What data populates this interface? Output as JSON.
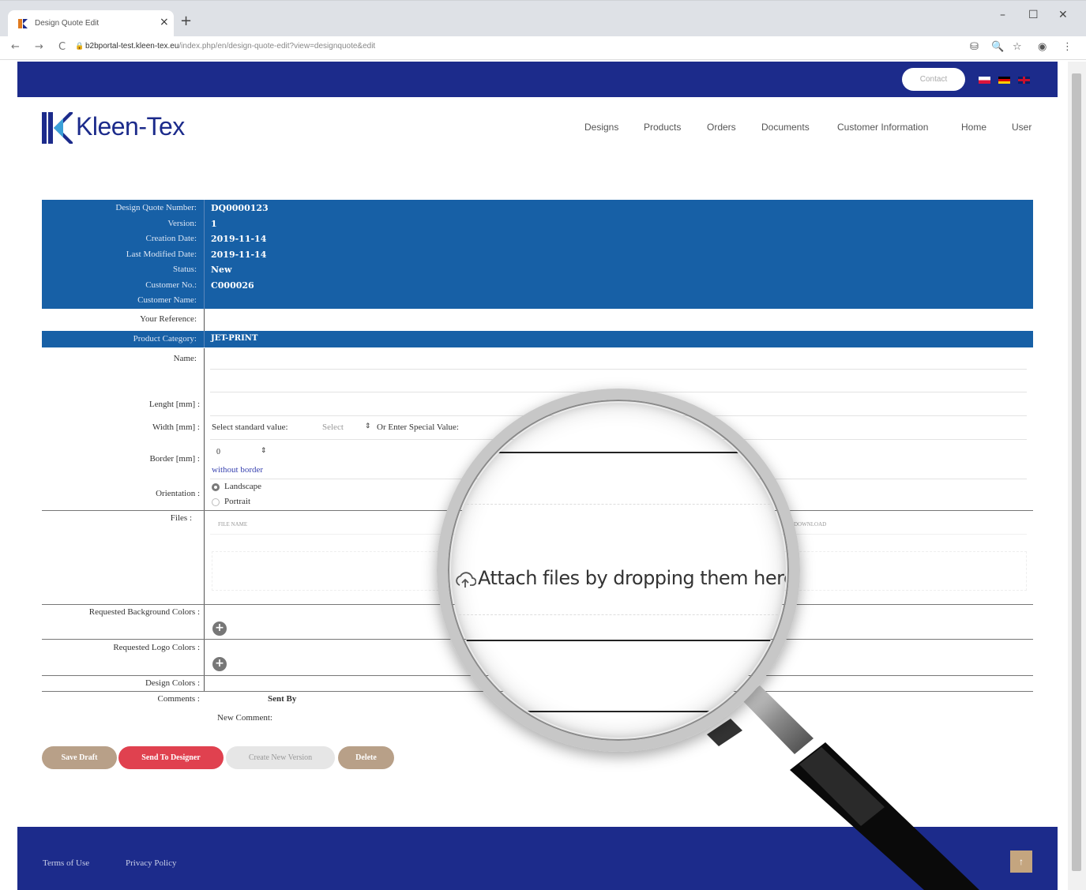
{
  "browser": {
    "tab_title": "Design Quote Edit",
    "close_glyph": "×",
    "new_tab_glyph": "+",
    "url_host": "b2bportal-test.kleen-tex.eu",
    "url_path": "/index.php/en/design-quote-edit?view=designquote&edit",
    "lock_icon": "🔒",
    "back_glyph": "←",
    "forward_glyph": "→",
    "reload_glyph": "C",
    "minimize_glyph": "–",
    "maximize_glyph": "☐",
    "close_window_glyph": "✕",
    "toolbar_icons": [
      "⛁",
      "🔍",
      "☆",
      "◉",
      "⋮"
    ]
  },
  "header": {
    "contact_label": "Contact",
    "logo_text": "Kleen-Tex",
    "nav": [
      "Designs",
      "Products",
      "Orders",
      "Documents",
      "Customer Information",
      "Home",
      "User"
    ]
  },
  "info": {
    "rows": [
      {
        "label": "Design Quote Number:",
        "value": "DQ0000123"
      },
      {
        "label": "Version:",
        "value": "1"
      },
      {
        "label": "Creation Date:",
        "value": "2019-11-14"
      },
      {
        "label": "Last Modified Date:",
        "value": "2019-11-14"
      },
      {
        "label": "Status:",
        "value": "New"
      },
      {
        "label": "Customer No.:",
        "value": "C000026"
      },
      {
        "label": "Customer Name:",
        "value": ""
      }
    ]
  },
  "form": {
    "your_reference_label": "Your Reference:",
    "product_category_label": "Product Category:",
    "product_category_value": "JET-PRINT",
    "name_label": "Name:",
    "length_label": "Lenght [mm] :",
    "width_label": "Width [mm] :",
    "width_select_text": "Select standard value:",
    "width_select_placeholder": "Select",
    "width_special_text": "Or Enter Special Value:",
    "border_label": "Border [mm] :",
    "border_value": "0",
    "without_border": "without border",
    "orientation_label": "Orientation :",
    "orientation_options": [
      "Landscape",
      "Portrait"
    ],
    "files_label": "Files :",
    "files_col_name": "FILE NAME",
    "files_col_download": "DOWNLOAD",
    "req_bg_colors_label": "Requested Background Colors :",
    "req_logo_colors_label": "Requested Logo Colors :",
    "design_colors_label": "Design Colors :",
    "comments_label": "Comments :",
    "sent_by_label": "Sent By",
    "new_comment_label": "New Comment:",
    "add_glyph": "+",
    "select_arrow_glyph": "⇕"
  },
  "actions": {
    "save_draft": "Save Draft",
    "send_to_designer": "Send To Designer",
    "create_new_version": "Create New Version",
    "delete": "Delete"
  },
  "footer": {
    "terms": "Terms of Use",
    "privacy": "Privacy Policy",
    "scroll_top_glyph": "↑"
  },
  "magnifier": {
    "drop_text": "Attach files by dropping them here"
  },
  "colors": {
    "brand_dark": "#1c2b8b",
    "form_blue": "#1760a6",
    "send_red": "#e0414f",
    "tan": "#b8a088"
  }
}
